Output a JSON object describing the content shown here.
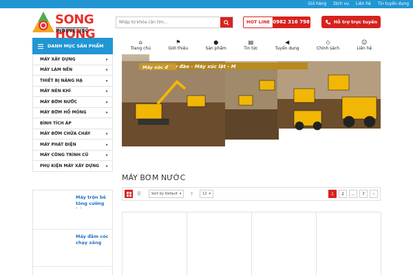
{
  "topbar": {
    "links": [
      "Giỏ hàng",
      "Dịch vụ",
      "Liên hệ",
      "Tin tuyển dụng"
    ]
  },
  "logo": {
    "brand": "SONG HONG",
    "subtitle": "INDEVE.,JSC"
  },
  "search": {
    "placeholder": "Nhập từ khóa cần tìm..."
  },
  "hotline": {
    "label": "HOT LINE",
    "number": "0982 316 798"
  },
  "support": {
    "label": "Hỗ trợ trực tuyến"
  },
  "categories": {
    "title": "DANH MỤC SẢN PHẨM",
    "items": [
      "MÁY XÂY DỰNG",
      "MÁY LÀM NỀN",
      "THIẾT BỊ NÂNG HẠ",
      "MÁY NÉN KHÍ",
      "MÁY BƠM NƯỚC",
      "MÁY BƠM HỐ MÓNG",
      "BÌNH TÍCH ÁP",
      "MÁY BƠM CHỮA CHÁY",
      "MÁY PHÁT ĐIỆN",
      "MÁY CÔNG TRÌNH CŨ",
      "PHỤ KIỆN MÁY XÂY DỰNG"
    ]
  },
  "nav": {
    "items": [
      "Trang chủ",
      "Giới thiệu",
      "Sản phẩm",
      "Tin tức",
      "Tuyển dụng",
      "Chính sách",
      "Liên hệ"
    ]
  },
  "banner": {
    "caption1": "Máy đào - Máy xúc lật - M",
    "caption2": "Máy xúc đ"
  },
  "section": {
    "title": "MÁY BƠM NƯỚC"
  },
  "toolbar": {
    "sort": "Sort by Default",
    "per_page": "12",
    "pages": [
      "1",
      "2",
      "...",
      "7",
      "›"
    ]
  },
  "side_products": [
    {
      "name": "Máy trộn bê tông cường bức"
    },
    {
      "name": "Máy đầm cóc chạy xăng"
    }
  ],
  "colors": {
    "accent": "#d7221f",
    "brand_blue": "#2196d3"
  }
}
